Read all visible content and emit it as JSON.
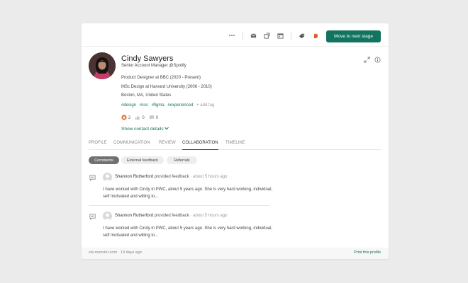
{
  "colors": {
    "accent": "#12735f",
    "background": "#ebebeb",
    "card": "#ffffff"
  },
  "toolbar": {
    "icons": [
      "more-icon",
      "email-icon",
      "share-icon",
      "calendar-icon",
      "tag-icon",
      "reject-icon"
    ],
    "move_label": "Move to next stage"
  },
  "profile": {
    "name": "Cindy Sawyers",
    "role": "Senior Account Manager @Spotify",
    "lines": [
      "Product Designer at BBC (2020 - Present)",
      "MSc Design at Harvard University (2006 - 2010)",
      "Boston, MA, United States"
    ],
    "tags": [
      "#design",
      "#css",
      "#figma",
      "#experienced"
    ],
    "add_tag": "+ add tag",
    "reactions": {
      "stars": "2",
      "likes": "0",
      "comments": "0"
    },
    "show_contact": "Show contact details"
  },
  "tabs": [
    "PROFILE",
    "COMMUNICATION",
    "REVIEW",
    "COLLABORATION",
    "TIMELINE"
  ],
  "active_tab": "COLLABORATION",
  "pills": [
    "Comments",
    "External feedback",
    "Referrals"
  ],
  "feedback": [
    {
      "author": "Shannon Rutherford",
      "action": "provided feedback",
      "time": "· about 5 hours ago",
      "text": "I have worked with Cindy in PWC, about 5 years ago .She is very hard working, individual, self motivated and willing to..."
    },
    {
      "author": "Shannon Rutherford",
      "action": "provided feedback",
      "time": "· about 5 hours ago",
      "text": "I have worked with Cindy in PWC, about 5 years ago .She is very hard working, individual, self motivated and willing to..."
    }
  ],
  "footer": {
    "source": "via monster.com · 14 days ago",
    "print": "Print this profile"
  }
}
